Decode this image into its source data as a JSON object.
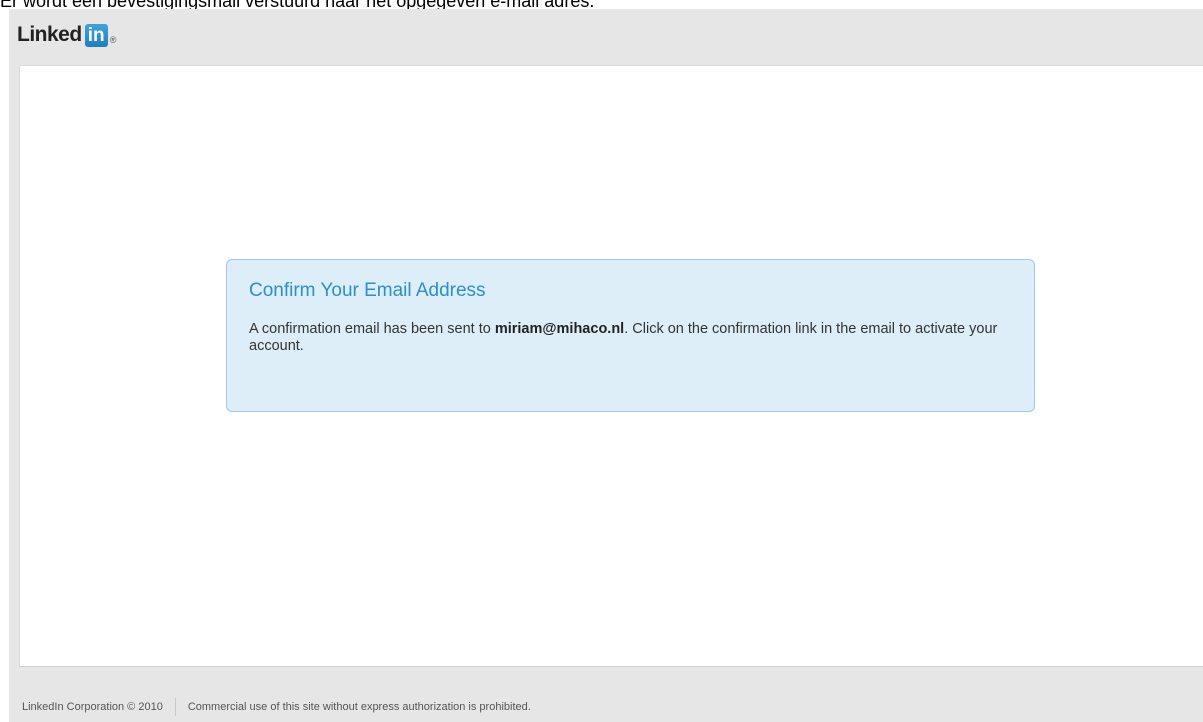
{
  "caption": "Er wordt een bevestigingsmail verstuurd naar het opgegeven e-mail adres.",
  "logo": {
    "word": "Linked",
    "box": "in",
    "registered": "®",
    "brand_color": "#2b8fcb"
  },
  "notice": {
    "title": "Confirm Your Email Address",
    "text_before": "A confirmation email has been sent to ",
    "email": "miriam@mihaco.nl",
    "text_after": ". Click on the confirmation link in the email to activate your account.",
    "background_color": "#ddeef8",
    "border_color": "#9ecbe6"
  },
  "footer": {
    "copyright": "LinkedIn Corporation © 2010",
    "notice": "Commercial use of this site without express authorization is prohibited."
  }
}
